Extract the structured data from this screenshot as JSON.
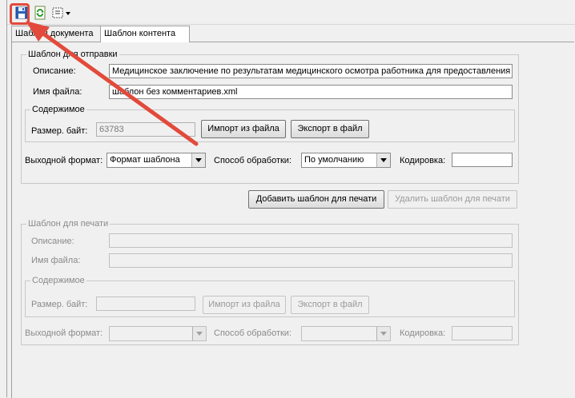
{
  "toolbar": {
    "save_icon": "save-icon",
    "refresh_icon": "refresh-icon",
    "layout_icon": "layout-dropdown-icon"
  },
  "tabs": [
    {
      "label": "Шаблон документа",
      "active": false
    },
    {
      "label": "Шаблон контента",
      "active": true
    }
  ],
  "send_template": {
    "legend": "Шаблон для отправки",
    "description_label": "Описание:",
    "description_value": "Медицинское заключение по результатам медицинского осмотра работника для предоставления",
    "filename_label": "Имя файла:",
    "filename_value": "шаблон без комментариев.xml",
    "content_legend": "Содержимое",
    "size_label": "Размер. байт:",
    "size_value": "63783",
    "import_button": "Импорт из файла",
    "export_button": "Экспорт в файл",
    "output_format_label": "Выходной формат:",
    "output_format_value": "Формат шаблона",
    "processing_label": "Способ обработки:",
    "processing_value": "По умолчанию",
    "encoding_label": "Кодировка:",
    "encoding_value": ""
  },
  "actions": {
    "add_print_template": "Добавить шаблон для печати",
    "remove_print_template": "Удалить шаблон для печати"
  },
  "print_template": {
    "legend": "Шаблон для печати",
    "description_label": "Описание:",
    "filename_label": "Имя файла:",
    "content_legend": "Содержимое",
    "size_label": "Размер. байт:",
    "import_button": "Импорт из файла",
    "export_button": "Экспорт в файл",
    "output_format_label": "Выходной формат:",
    "processing_label": "Способ обработки:",
    "encoding_label": "Кодировка:"
  },
  "colors": {
    "annotation": "#e24a3b"
  }
}
